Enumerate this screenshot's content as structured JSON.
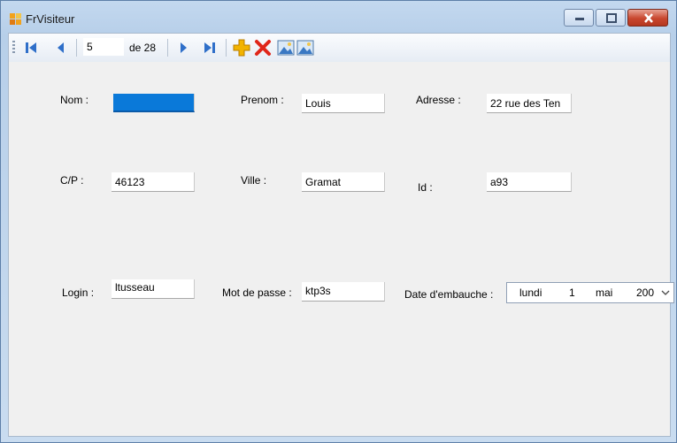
{
  "window": {
    "title": "FrVisiteur"
  },
  "toolbar": {
    "position_value": "5",
    "count_label": "de 28"
  },
  "form": {
    "nom": {
      "label": "Nom :",
      "value": ""
    },
    "prenom": {
      "label": "Prenom :",
      "value": "Louis"
    },
    "adresse": {
      "label": "Adresse :",
      "value": "22 rue des Ten"
    },
    "cp": {
      "label": "C/P :",
      "value": "46123"
    },
    "ville": {
      "label": "Ville :",
      "value": "Gramat"
    },
    "id": {
      "label": "Id :",
      "value": "a93"
    },
    "login": {
      "label": "Login :",
      "value": "ltusseau"
    },
    "mdp": {
      "label": "Mot de passe :",
      "value": "ktp3s"
    },
    "embauche": {
      "label": "Date d'embauche :",
      "day_name": "lundi",
      "day": "1",
      "month": "mai",
      "year": "200"
    }
  },
  "colors": {
    "selection": "#0a79d9",
    "nav_arrow": "#2f6fc9",
    "add_icon": "#f2b300",
    "delete_icon": "#e0261a"
  }
}
